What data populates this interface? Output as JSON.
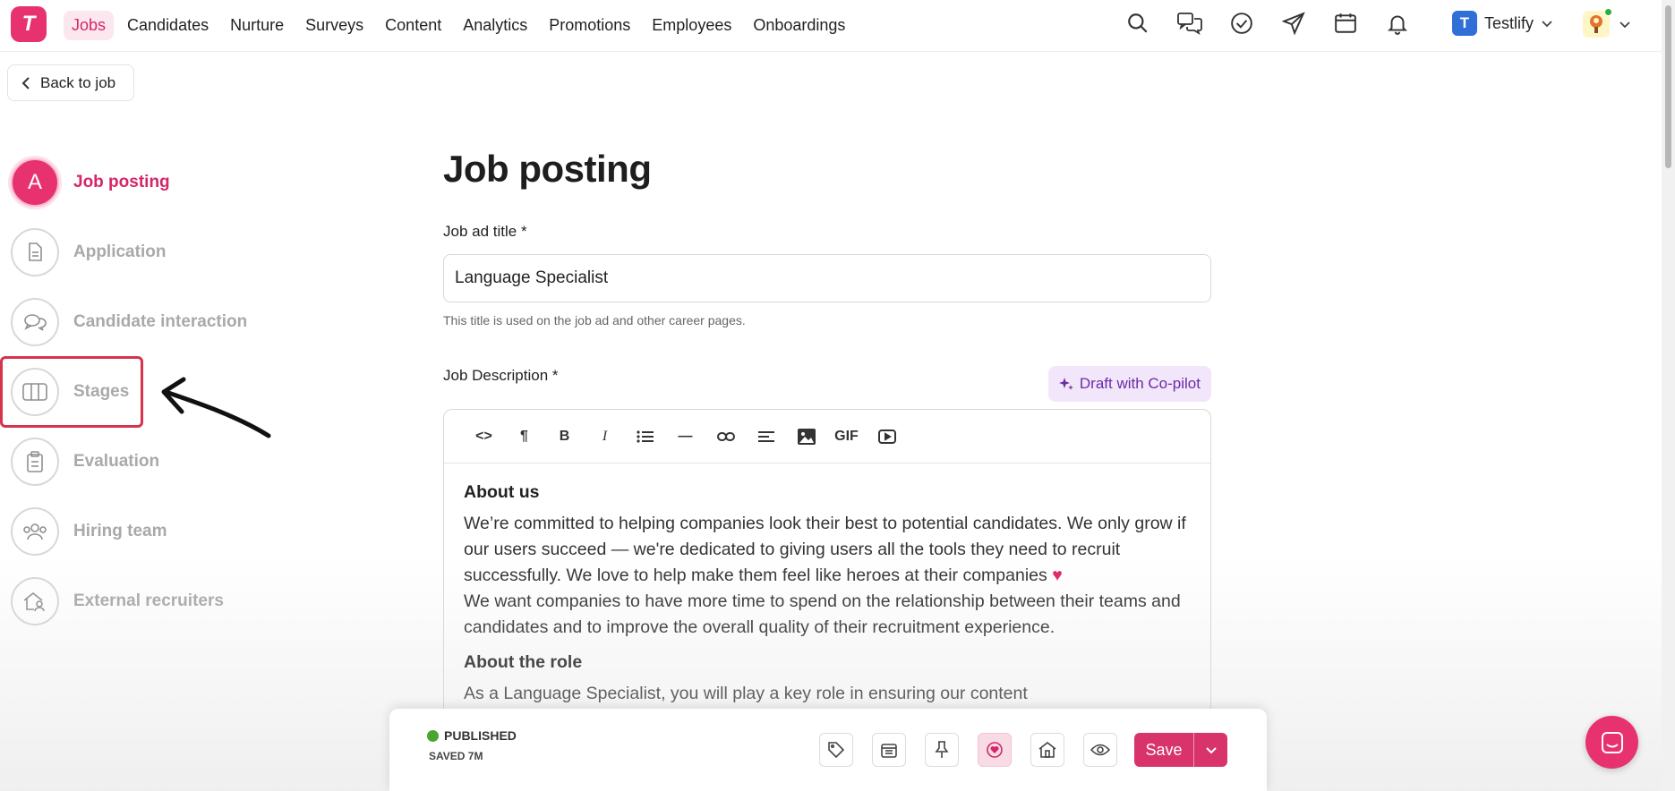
{
  "nav": {
    "items": [
      "Jobs",
      "Candidates",
      "Nurture",
      "Surveys",
      "Content",
      "Analytics",
      "Promotions",
      "Employees",
      "Onboardings"
    ],
    "active": "Jobs",
    "logo_letter": "T",
    "icons": [
      "search-icon",
      "chat-icon",
      "check-circle-icon",
      "send-icon",
      "calendar-icon",
      "bell-icon"
    ],
    "workspace_initial": "T",
    "workspace_name": "Testlify"
  },
  "back_label": "Back to job",
  "steps": [
    {
      "label": "Job posting",
      "icon": "A",
      "active": true
    },
    {
      "label": "Application",
      "icon": "document-icon"
    },
    {
      "label": "Candidate interaction",
      "icon": "chat-bubbles-icon"
    },
    {
      "label": "Stages",
      "icon": "columns-icon"
    },
    {
      "label": "Evaluation",
      "icon": "clipboard-icon"
    },
    {
      "label": "Hiring team",
      "icon": "team-icon"
    },
    {
      "label": "External recruiters",
      "icon": "external-recruiter-icon"
    }
  ],
  "main": {
    "title": "Job posting",
    "title_label": "Job ad title *",
    "title_value": "Language Specialist",
    "title_hint": "This title is used on the job ad and other career pages.",
    "description_label": "Job Description *",
    "copilot_label": "Draft with Co-pilot",
    "toolbar": [
      "<>",
      "¶",
      "B",
      "I",
      "list",
      "—",
      "link",
      "align",
      "image",
      "GIF",
      "video"
    ],
    "content": {
      "about_us_heading": "About us",
      "about_us_p1": "We’re committed to helping companies look their best to potential candidates. We only grow if our users succeed — we're dedicated to giving users all the tools they need to recruit successfully. We love to help make them feel like heroes at their companies",
      "about_us_heart": "♥",
      "about_us_p2": "We want companies to have more time to spend on the relationship between their teams and candidates and to improve the overall quality of their recruitment experience.",
      "about_role_heading": "About the role",
      "about_role_p1": "As a Language Specialist, you will play a key role in ensuring our content"
    }
  },
  "bottom_bar": {
    "status": "PUBLISHED",
    "saved": "SAVED 7M",
    "icons": [
      "tag-icon",
      "calendar-icon",
      "pin-icon",
      "heart-icon",
      "home-icon",
      "eye-icon"
    ],
    "save_label": "Save"
  },
  "colors": {
    "brand": "#e8326f",
    "highlight": "#d8334d",
    "published": "#4aa52e"
  }
}
